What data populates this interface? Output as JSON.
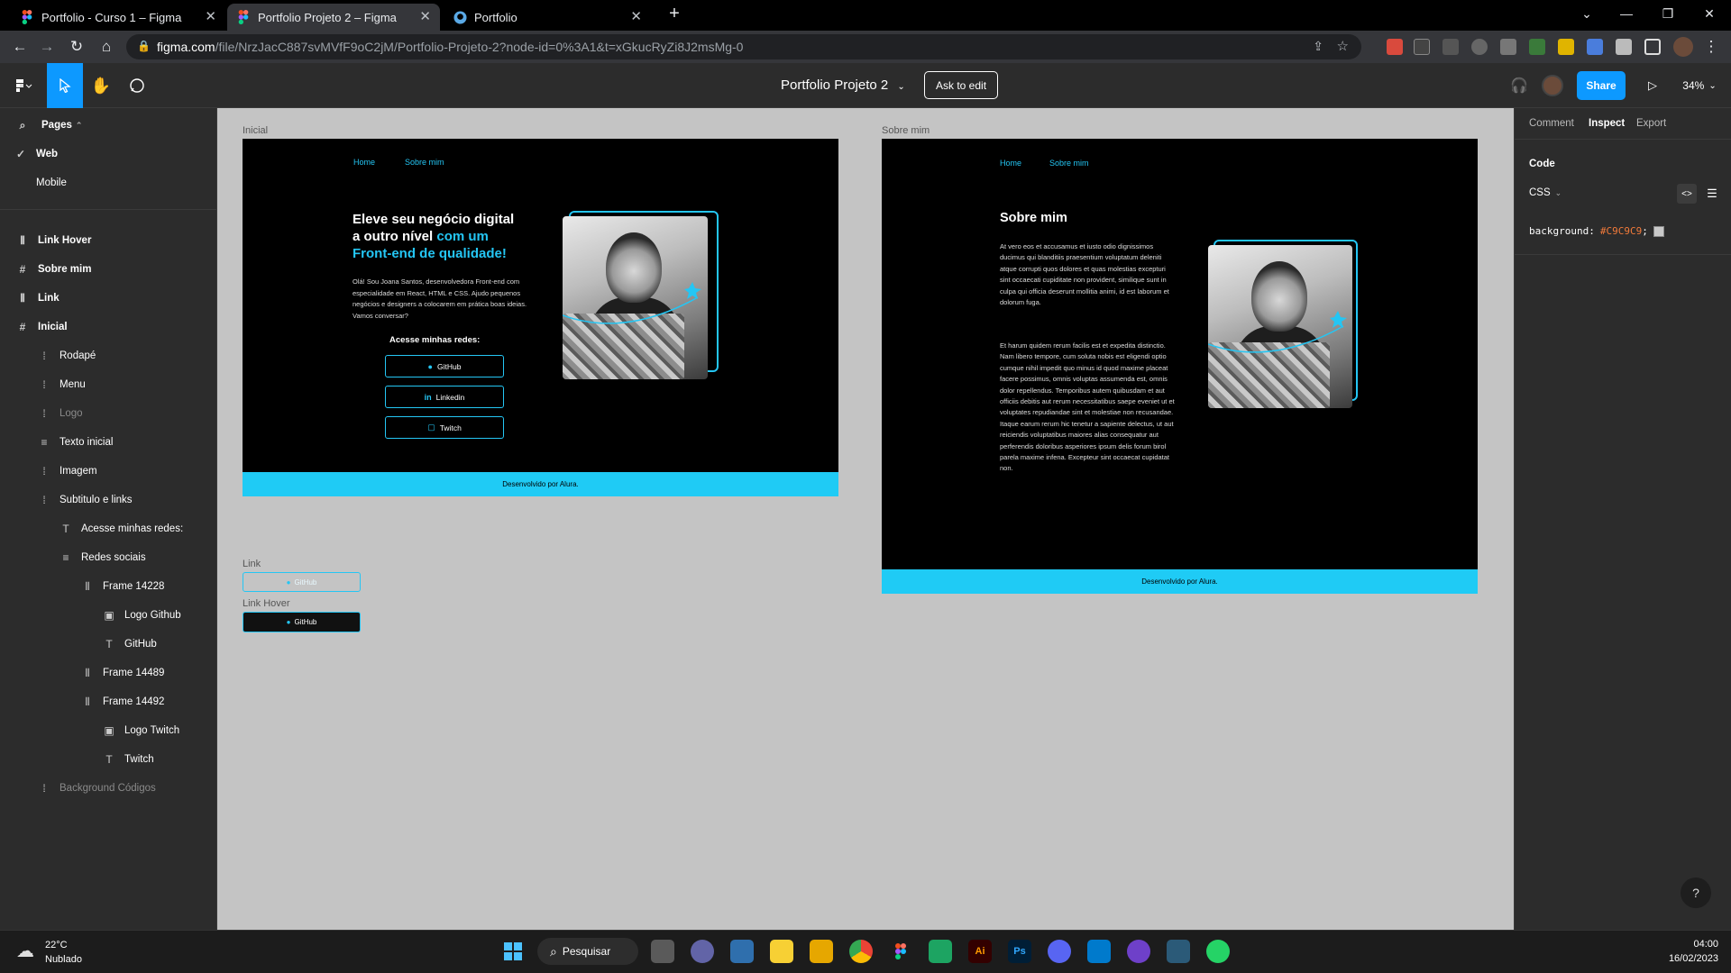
{
  "browser": {
    "tabs": [
      {
        "title": "Portfolio - Curso 1 – Figma",
        "active": false,
        "icon": "figma-icon"
      },
      {
        "title": "Portfolio Projeto 2 – Figma",
        "active": true,
        "icon": "figma-icon"
      },
      {
        "title": "Portfolio",
        "active": false,
        "icon": "github-icon"
      }
    ],
    "url_host": "figma.com",
    "url_path": "/file/NrzJacC887svMVfF9oC2jM/Portfolio-Projeto-2?node-id=0%3A1&t=xGkucRyZi8J2msMg-0"
  },
  "toolbar": {
    "file_title": "Portfolio Projeto 2",
    "ask_to_edit": "Ask to edit",
    "share": "Share",
    "zoom": "34%"
  },
  "left_panel": {
    "pages_header": "Pages",
    "pages": [
      {
        "label": "Web",
        "selected": true
      },
      {
        "label": "Mobile",
        "selected": false
      }
    ],
    "layers": [
      {
        "label": "Link Hover",
        "icon": "autolayout-icon",
        "indent": 0,
        "bold": true,
        "dim": false
      },
      {
        "label": "Sobre mim",
        "icon": "frame-icon",
        "indent": 0,
        "bold": true,
        "dim": false
      },
      {
        "label": "Link",
        "icon": "autolayout-icon",
        "indent": 0,
        "bold": true,
        "dim": false
      },
      {
        "label": "Inicial",
        "icon": "frame-icon",
        "indent": 0,
        "bold": true,
        "dim": false
      },
      {
        "label": "Rodapé",
        "icon": "group-icon",
        "indent": 1,
        "bold": false,
        "dim": false
      },
      {
        "label": "Menu",
        "icon": "group-icon",
        "indent": 1,
        "bold": false,
        "dim": false
      },
      {
        "label": "Logo",
        "icon": "group-icon",
        "indent": 1,
        "bold": false,
        "dim": true
      },
      {
        "label": "Texto inicial",
        "icon": "list-icon",
        "indent": 1,
        "bold": false,
        "dim": false
      },
      {
        "label": "Imagem",
        "icon": "group-icon",
        "indent": 1,
        "bold": false,
        "dim": false
      },
      {
        "label": "Subtitulo e links",
        "icon": "group-icon",
        "indent": 1,
        "bold": false,
        "dim": false
      },
      {
        "label": "Acesse minhas redes:",
        "icon": "text-icon",
        "indent": 2,
        "bold": false,
        "dim": false
      },
      {
        "label": "Redes sociais",
        "icon": "list-icon",
        "indent": 2,
        "bold": false,
        "dim": false
      },
      {
        "label": "Frame 14228",
        "icon": "autolayout-icon",
        "indent": 3,
        "bold": false,
        "dim": false
      },
      {
        "label": "Logo Github",
        "icon": "image-icon",
        "indent": 4,
        "bold": false,
        "dim": false
      },
      {
        "label": "GitHub",
        "icon": "text-icon",
        "indent": 4,
        "bold": false,
        "dim": false
      },
      {
        "label": "Frame 14489",
        "icon": "autolayout-icon",
        "indent": 3,
        "bold": false,
        "dim": false
      },
      {
        "label": "Frame 14492",
        "icon": "autolayout-icon",
        "indent": 3,
        "bold": false,
        "dim": false
      },
      {
        "label": "Logo Twitch",
        "icon": "image-icon",
        "indent": 4,
        "bold": false,
        "dim": false
      },
      {
        "label": "Twitch",
        "icon": "text-icon",
        "indent": 4,
        "bold": false,
        "dim": false
      },
      {
        "label": "Background Códigos",
        "icon": "group-icon",
        "indent": 1,
        "bold": false,
        "dim": true
      }
    ]
  },
  "canvas": {
    "inicial": {
      "label": "Inicial",
      "nav_home": "Home",
      "nav_sobre": "Sobre mim",
      "headline_1": "Eleve seu negócio digital",
      "headline_2a": "a outro nível ",
      "headline_2b": "com um",
      "headline_3": "Front-end de qualidade!",
      "intro": "Olá! Sou Joana Santos, desenvolvedora Front-end com especialidade em React, HTML e CSS. Ajudo pequenos negócios e designers a colocarem em prática boas ideias. Vamos conversar?",
      "redes_title": "Acesse minhas redes:",
      "buttons": [
        {
          "label": "GitHub",
          "icon": "github-icon"
        },
        {
          "label": "Linkedin",
          "icon": "linkedin-icon"
        },
        {
          "label": "Twitch",
          "icon": "twitch-icon"
        }
      ],
      "footer": "Desenvolvido por Alura."
    },
    "sobre": {
      "label": "Sobre mim",
      "nav_home": "Home",
      "nav_sobre": "Sobre mim",
      "title": "Sobre mim",
      "para1": "At vero eos et accusamus et iusto odio dignissimos ducimus qui blanditiis praesentium voluptatum deleniti atque corrupti quos dolores et quas molestias excepturi sint occaecati cupiditate non provident, similique sunt in culpa qui officia deserunt mollitia animi, id est laborum et dolorum fuga.",
      "para2": "Et harum quidem rerum facilis est et expedita distinctio. Nam libero tempore, cum soluta nobis est eligendi optio cumque nihil impedit quo minus id quod maxime placeat facere possimus, omnis voluptas assumenda est, omnis dolor repellendus. Temporibus autem quibusdam et aut officiis debitis aut rerum necessitatibus saepe eveniet ut et voluptates repudiandae sint et molestiae non recusandae. Itaque earum rerum hic tenetur a sapiente delectus, ut aut reiciendis voluptatibus maiores alias consequatur aut perferendis doloribus asperiores ipsum delis forum birol parela maxime infena. Excepteur sint occaecat cupidatat non.",
      "footer": "Desenvolvido por Alura."
    },
    "link_label": "Link",
    "link_btn": "GitHub",
    "link_hover_label": "Link Hover",
    "link_hover_btn": "GitHub"
  },
  "right_panel": {
    "tabs": [
      "Comment",
      "Inspect",
      "Export"
    ],
    "active_tab": "Inspect",
    "code_heading": "Code",
    "lang": "CSS",
    "prop": "background:",
    "value": "#C9C9C9",
    "value_color": "#C9C9C9"
  },
  "taskbar": {
    "temp": "22°C",
    "weather": "Nublado",
    "search": "Pesquisar",
    "time": "04:00",
    "date": "16/02/2023"
  },
  "colors": {
    "accent": "#24c6f4",
    "figma_blue": "#0d99ff",
    "canvas_bg": "#c4c4c4"
  }
}
